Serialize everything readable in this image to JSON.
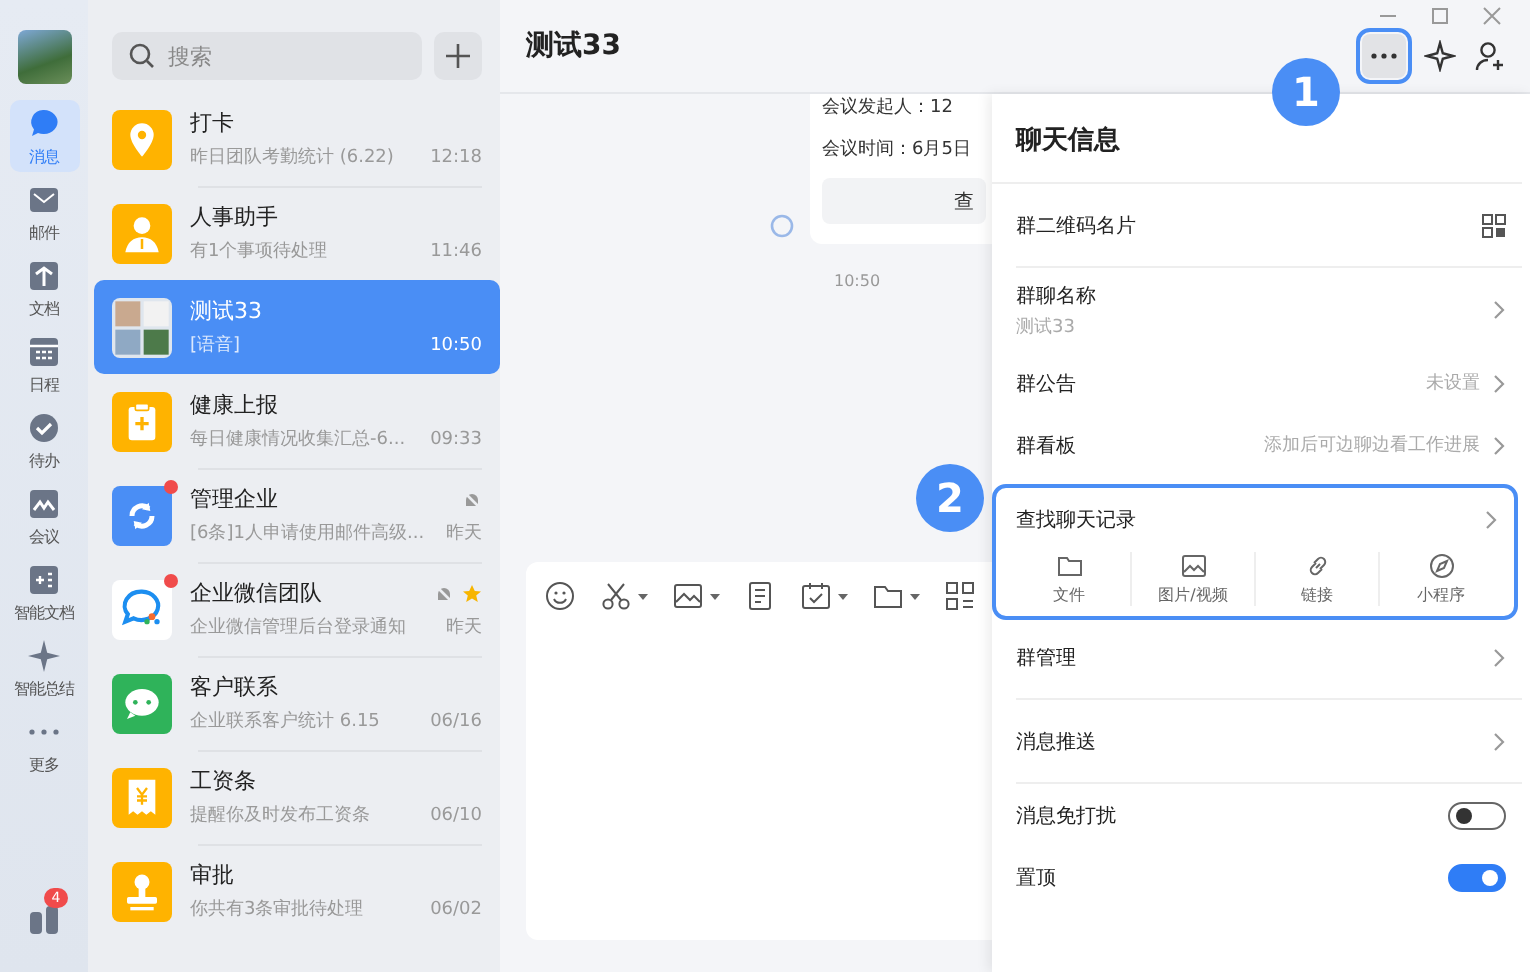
{
  "nav": {
    "items": [
      {
        "label": "消息",
        "kind": "chat",
        "selected": true
      },
      {
        "label": "邮件",
        "kind": "mail",
        "selected": false
      },
      {
        "label": "文档",
        "kind": "doc",
        "selected": false
      },
      {
        "label": "日程",
        "kind": "calendar",
        "selected": false
      },
      {
        "label": "待办",
        "kind": "check",
        "selected": false
      },
      {
        "label": "会议",
        "kind": "meeting",
        "selected": false
      },
      {
        "label": "智能文档",
        "kind": "smartdoc",
        "selected": false
      },
      {
        "label": "智能总结",
        "kind": "sparkle",
        "selected": false
      },
      {
        "label": "更多",
        "kind": "more",
        "selected": false
      }
    ],
    "bottom_badge": "4"
  },
  "search": {
    "placeholder": "搜索"
  },
  "chats": [
    {
      "title": "打卡",
      "preview": "昨日团队考勤统计 (6.22)",
      "time": "12:18",
      "kind": "pin",
      "color": "#ffb300",
      "selected": false,
      "unread": false,
      "muted": false,
      "starred": false
    },
    {
      "title": "人事助手",
      "preview": "有1个事项待处理",
      "time": "11:46",
      "kind": "person",
      "color": "#ffb300",
      "selected": false,
      "unread": false,
      "muted": false,
      "starred": false
    },
    {
      "title": "测试33",
      "preview": "[语音]",
      "time": "10:50",
      "kind": "group",
      "color": "#dfe6ee",
      "selected": true,
      "unread": false,
      "muted": false,
      "starred": false
    },
    {
      "title": "健康上报",
      "preview": "每日健康情况收集汇总-6...",
      "time": "09:33",
      "kind": "clipboard",
      "color": "#ffb300",
      "selected": false,
      "unread": false,
      "muted": false,
      "starred": false
    },
    {
      "title": "管理企业",
      "preview": "[6条]1人申请使用邮件高级...",
      "time": "昨天",
      "kind": "sync",
      "color": "#4a8ef5",
      "selected": false,
      "unread": true,
      "muted": true,
      "starred": false
    },
    {
      "title": "企业微信团队",
      "preview": "企业微信管理后台登录通知",
      "time": "昨天",
      "kind": "bubble",
      "color": "#ffffff",
      "selected": false,
      "unread": true,
      "muted": true,
      "starred": true
    },
    {
      "title": "客户联系",
      "preview": "企业联系客户统计 6.15",
      "time": "06/16",
      "kind": "wechat",
      "color": "#2fb35a",
      "selected": false,
      "unread": false,
      "muted": false,
      "starred": false
    },
    {
      "title": "工资条",
      "preview": "提醒你及时发布工资条",
      "time": "06/10",
      "kind": "receipt",
      "color": "#ffb300",
      "selected": false,
      "unread": false,
      "muted": false,
      "starred": false
    },
    {
      "title": "审批",
      "preview": "你共有3条审批待处理",
      "time": "06/02",
      "kind": "stamp",
      "color": "#ffb300",
      "selected": false,
      "unread": false,
      "muted": false,
      "starred": false
    }
  ],
  "chat": {
    "title": "测试33",
    "more_highlighted": true,
    "message": {
      "lines": [
        "会议发起人：12",
        "会议时间：6月5日"
      ],
      "button": "查",
      "time": "10:50"
    }
  },
  "panel": {
    "title": "聊天信息",
    "rows": [
      {
        "kind": "qr",
        "label": "群二维码名片",
        "divider": true
      },
      {
        "kind": "nav",
        "label": "群聊名称",
        "sub": "测试33"
      },
      {
        "kind": "nav",
        "label": "群公告",
        "value": "未设置"
      },
      {
        "kind": "nav",
        "label": "群看板",
        "value": "添加后可边聊边看工作进展"
      },
      {
        "kind": "search",
        "label": "查找聊天记录",
        "highlighted": true,
        "actions": [
          {
            "label": "文件",
            "kind": "folder"
          },
          {
            "label": "图片/视频",
            "kind": "image"
          },
          {
            "label": "链接",
            "kind": "link"
          },
          {
            "label": "小程序",
            "kind": "compass"
          }
        ]
      },
      {
        "kind": "nav",
        "label": "群管理",
        "divider": true
      },
      {
        "kind": "nav",
        "label": "消息推送",
        "divider": true
      },
      {
        "kind": "toggle",
        "label": "消息免打扰",
        "on": false
      },
      {
        "kind": "toggle",
        "label": "置顶",
        "on": true
      }
    ]
  },
  "annotations": [
    {
      "label": "1"
    },
    {
      "label": "2"
    }
  ]
}
